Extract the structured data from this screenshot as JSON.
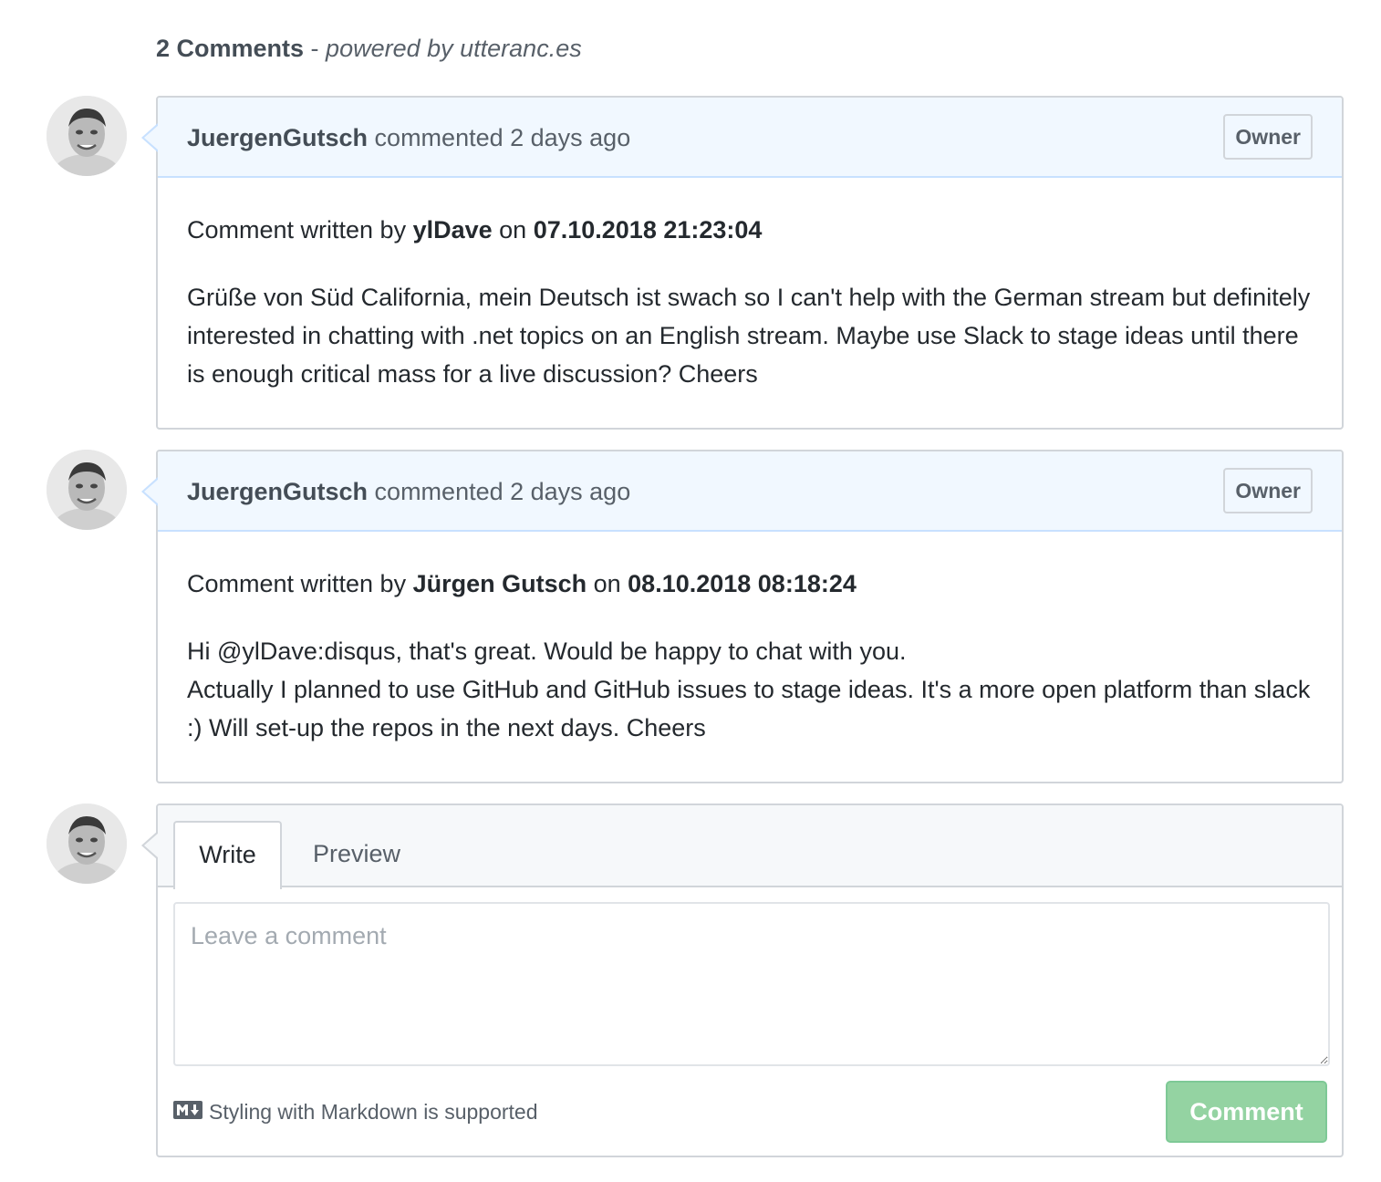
{
  "header": {
    "count": "2 Comments",
    "separator": " - ",
    "powered": "powered by utteranc.es"
  },
  "comments": [
    {
      "author": "JuergenGutsch",
      "action": " commented 2 days ago",
      "badge": "Owner",
      "byline_prefix": "Comment written by ",
      "byline_name": "ylDave",
      "byline_on": " on ",
      "byline_date": "07.10.2018 21:23:04",
      "lines": [
        "Grüße von Süd California, mein Deutsch ist swach so I can't help with the German stream but definitely interested in chatting with .net topics on an English stream. Maybe use Slack to stage ideas until there is enough critical mass for a live discussion? Cheers"
      ]
    },
    {
      "author": "JuergenGutsch",
      "action": " commented 2 days ago",
      "badge": "Owner",
      "byline_prefix": "Comment written by ",
      "byline_name": "Jürgen Gutsch",
      "byline_on": " on ",
      "byline_date": "08.10.2018 08:18:24",
      "lines": [
        "Hi @ylDave:disqus, that's great. Would be happy to chat with you.",
        "Actually I planned to use GitHub and GitHub issues to stage ideas. It's a more open platform than slack :) Will set-up the repos in the next days. Cheers"
      ]
    }
  ],
  "new_comment": {
    "tabs": [
      "Write",
      "Preview"
    ],
    "placeholder": "Leave a comment",
    "markdown_hint": "Styling with Markdown is supported",
    "submit_label": "Comment"
  },
  "colors": {
    "header_bg": "#f1f8ff",
    "header_border": "#c8e1ff",
    "button_green": "#94d3a2"
  },
  "icons": {
    "avatar": "user-avatar",
    "markdown": "markdown-icon"
  }
}
